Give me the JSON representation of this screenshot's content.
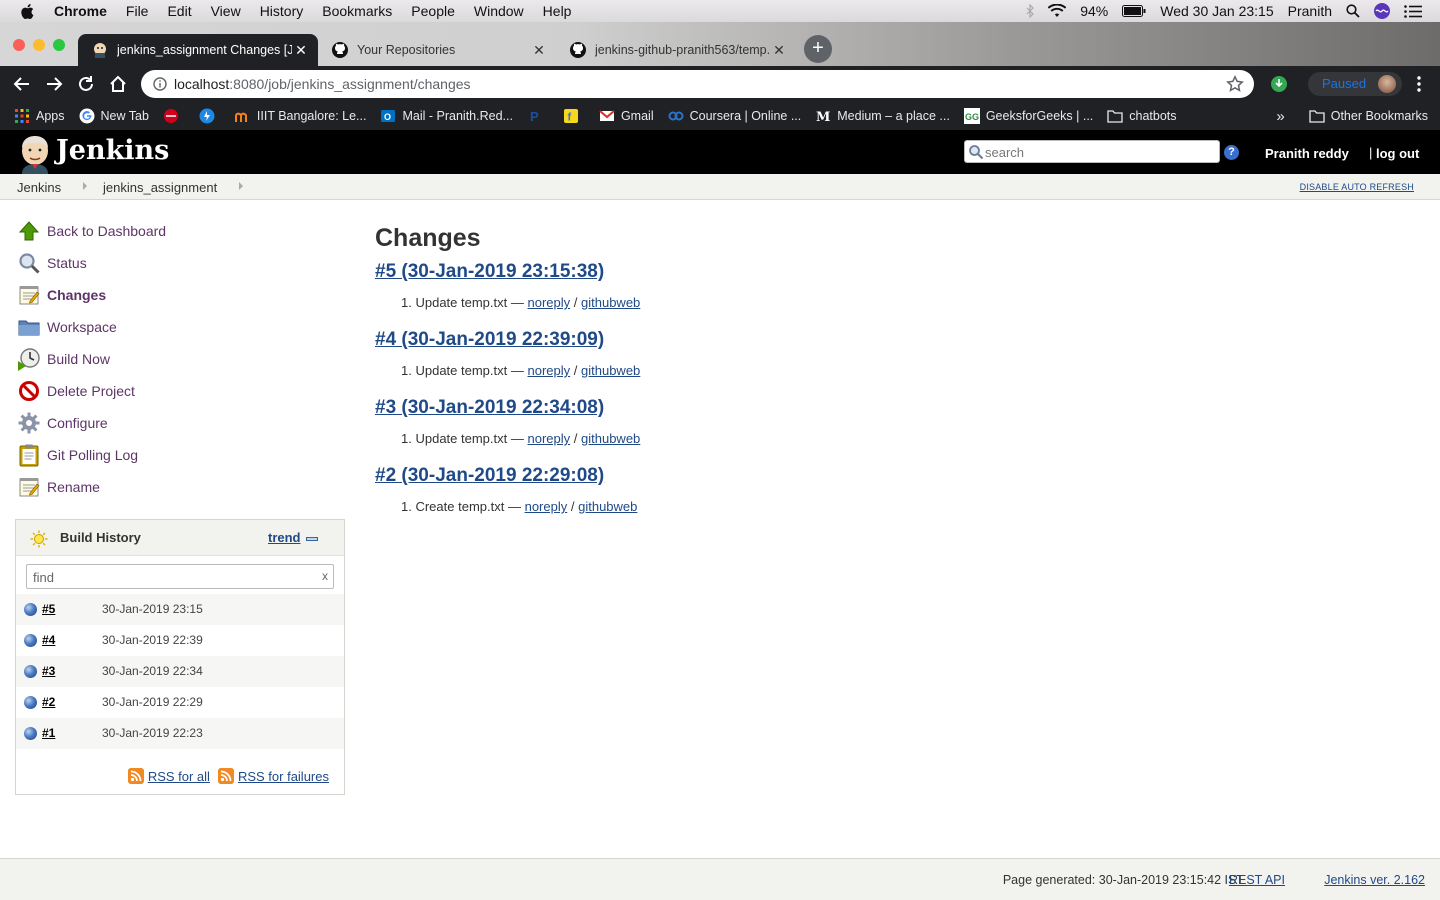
{
  "menubar": {
    "app_name": "Chrome",
    "items": [
      "File",
      "Edit",
      "View",
      "History",
      "Bookmarks",
      "People",
      "Window",
      "Help"
    ],
    "battery": "94%",
    "datetime": "Wed 30 Jan  23:15",
    "user": "Pranith"
  },
  "tabs": [
    {
      "title": "jenkins_assignment Changes [Jenkins]",
      "active": true
    },
    {
      "title": "Your Repositories",
      "active": false
    },
    {
      "title": "jenkins-github-pranith563/temp.txt",
      "active": false
    }
  ],
  "toolbar": {
    "url_host": "localhost",
    "url_rest": ":8080/job/jenkins_assignment/changes",
    "profile_status": "Paused"
  },
  "bookmarks": {
    "items": [
      {
        "label": "Apps",
        "icon": "apps-grid-icon"
      },
      {
        "label": "New Tab",
        "icon": "google-icon"
      },
      {
        "label": "",
        "icon": "red-icon"
      },
      {
        "label": "",
        "icon": "blue-icon"
      },
      {
        "label": "IIIT Bangalore: Le...",
        "icon": "moodle-icon"
      },
      {
        "label": "Mail - Pranith.Red...",
        "icon": "outlook-icon"
      },
      {
        "label": "",
        "icon": "paytm-icon"
      },
      {
        "label": "",
        "icon": "flipkart-icon"
      },
      {
        "label": "Gmail",
        "icon": "gmail-icon"
      },
      {
        "label": "Coursera | Online ...",
        "icon": "coursera-icon"
      },
      {
        "label": "Medium – a place ...",
        "icon": "medium-icon"
      },
      {
        "label": "GeeksforGeeks | ...",
        "icon": "geeksforgeeks-icon"
      },
      {
        "label": "chatbots",
        "icon": "folder-icon"
      }
    ],
    "overflow": "»",
    "other": "Other Bookmarks"
  },
  "jenkins": {
    "title": "Jenkins",
    "search_placeholder": "search",
    "help": "?",
    "user": "Pranith reddy",
    "separator": "|",
    "logout": "log out"
  },
  "breadcrumbs": [
    "Jenkins",
    "jenkins_assignment"
  ],
  "auto_refresh": "DISABLE AUTO REFRESH",
  "tasks": [
    {
      "label": "Back to Dashboard",
      "icon": "up-arrow-icon"
    },
    {
      "label": "Status",
      "icon": "magnifier-icon"
    },
    {
      "label": "Changes",
      "icon": "notepad-icon"
    },
    {
      "label": "Workspace",
      "icon": "folder-icon"
    },
    {
      "label": "Build Now",
      "icon": "clock-build-icon"
    },
    {
      "label": "Delete Project",
      "icon": "no-entry-icon"
    },
    {
      "label": "Configure",
      "icon": "gear-icon"
    },
    {
      "label": "Git Polling Log",
      "icon": "clipboard-icon"
    },
    {
      "label": "Rename",
      "icon": "notepad-icon"
    }
  ],
  "build_history": {
    "title": "Build History",
    "trend": "trend",
    "filter_placeholder": "find",
    "clear": "x",
    "builds": [
      {
        "num": "#5",
        "date": "30-Jan-2019 23:15"
      },
      {
        "num": "#4",
        "date": "30-Jan-2019 22:39"
      },
      {
        "num": "#3",
        "date": "30-Jan-2019 22:34"
      },
      {
        "num": "#2",
        "date": "30-Jan-2019 22:29"
      },
      {
        "num": "#1",
        "date": "30-Jan-2019 22:23"
      }
    ],
    "rss_all": "RSS for all",
    "rss_failures": "RSS for failures"
  },
  "main": {
    "heading": "Changes",
    "changesets": [
      {
        "title": "#5 (30-Jan-2019 23:15:38)",
        "index": "1.",
        "message": "Update temp.txt",
        "dash": "—",
        "author": "noreply",
        "slash": "/",
        "link": "githubweb"
      },
      {
        "title": "#4 (30-Jan-2019 22:39:09)",
        "index": "1.",
        "message": "Update temp.txt",
        "dash": "—",
        "author": "noreply",
        "slash": "/",
        "link": "githubweb"
      },
      {
        "title": "#3 (30-Jan-2019 22:34:08)",
        "index": "1.",
        "message": "Update temp.txt",
        "dash": "—",
        "author": "noreply",
        "slash": "/",
        "link": "githubweb"
      },
      {
        "title": "#2 (30-Jan-2019 22:29:08)",
        "index": "1.",
        "message": "Create temp.txt",
        "dash": "—",
        "author": "noreply",
        "slash": "/",
        "link": "githubweb"
      }
    ]
  },
  "footer": {
    "generated": "Page generated: 30-Jan-2019 23:15:42 IST",
    "rest_api": "REST API",
    "version": "Jenkins ver. 2.162"
  }
}
